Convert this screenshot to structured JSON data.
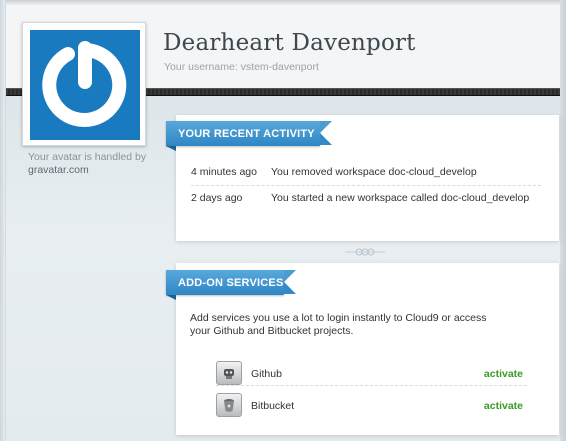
{
  "profile": {
    "name": "Dearheart Davenport",
    "username": "Your username: vstem-davenport",
    "avatar_icon": "power-logo-icon",
    "avatar_color": "#1a7ac0",
    "avatar_note_prefix": "Your avatar is handled by",
    "avatar_note_link": "gravatar.com"
  },
  "activity": {
    "title": "YOUR RECENT ACTIVITY",
    "items": [
      {
        "time": "4 minutes ago",
        "text": "You removed workspace doc-cloud_develop"
      },
      {
        "time": "2 days ago",
        "text": "You started a new workspace called doc-cloud_develop"
      }
    ]
  },
  "addons": {
    "title": "ADD-ON SERVICES",
    "description": "Add services you use a lot to login instantly to Cloud9 or access your Github and Bitbucket projects.",
    "services": [
      {
        "name": "Github",
        "icon": "github-icon",
        "action": "activate"
      },
      {
        "name": "Bitbucket",
        "icon": "bitbucket-icon",
        "action": "activate"
      }
    ]
  },
  "colors": {
    "ribbon": "#2f86c4",
    "activate": "#3a9b24"
  }
}
